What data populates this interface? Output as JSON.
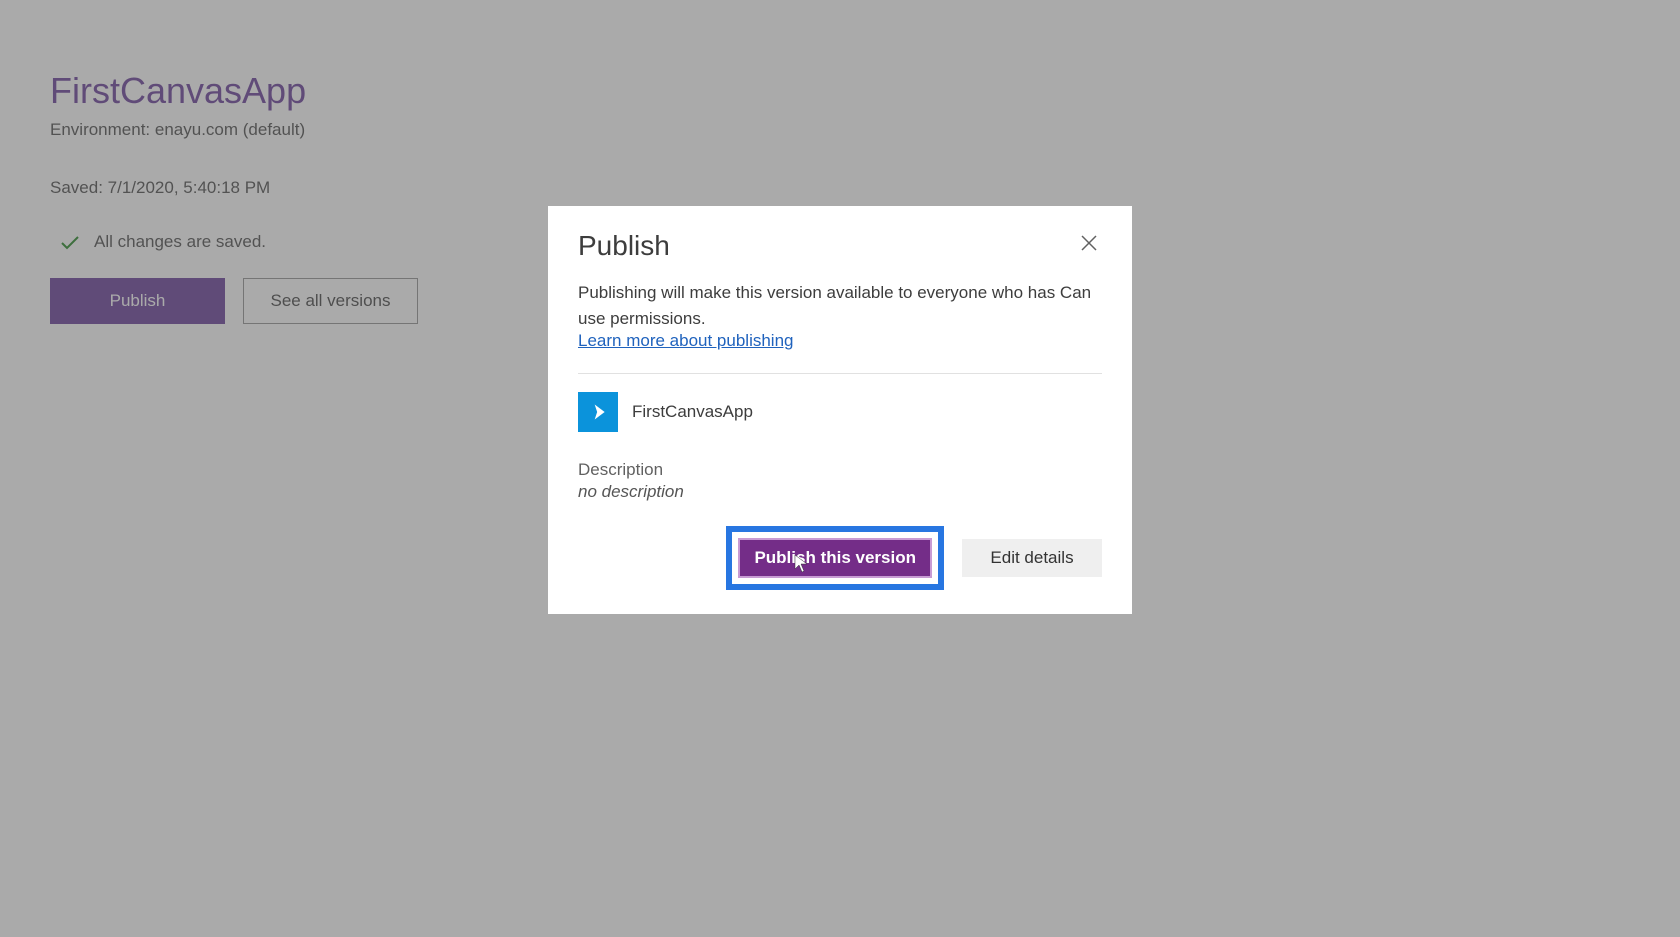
{
  "header": {
    "app_title": "FirstCanvasApp",
    "environment": "Environment: enayu.com (default)",
    "saved": "Saved: 7/1/2020, 5:40:18 PM"
  },
  "status": {
    "text": "All changes are saved."
  },
  "buttons": {
    "publish": "Publish",
    "see_all_versions": "See all versions"
  },
  "dialog": {
    "title": "Publish",
    "description": "Publishing will make this version available to everyone who has Can use permissions.",
    "learn_more": "Learn more about publishing",
    "app_name": "FirstCanvasApp",
    "description_label": "Description",
    "description_value": "no description",
    "publish_this_version": "Publish this version",
    "edit_details": "Edit details"
  },
  "colors": {
    "accent": "#5c2e91",
    "highlight": "#2776e1",
    "app_icon": "#0b93db"
  }
}
